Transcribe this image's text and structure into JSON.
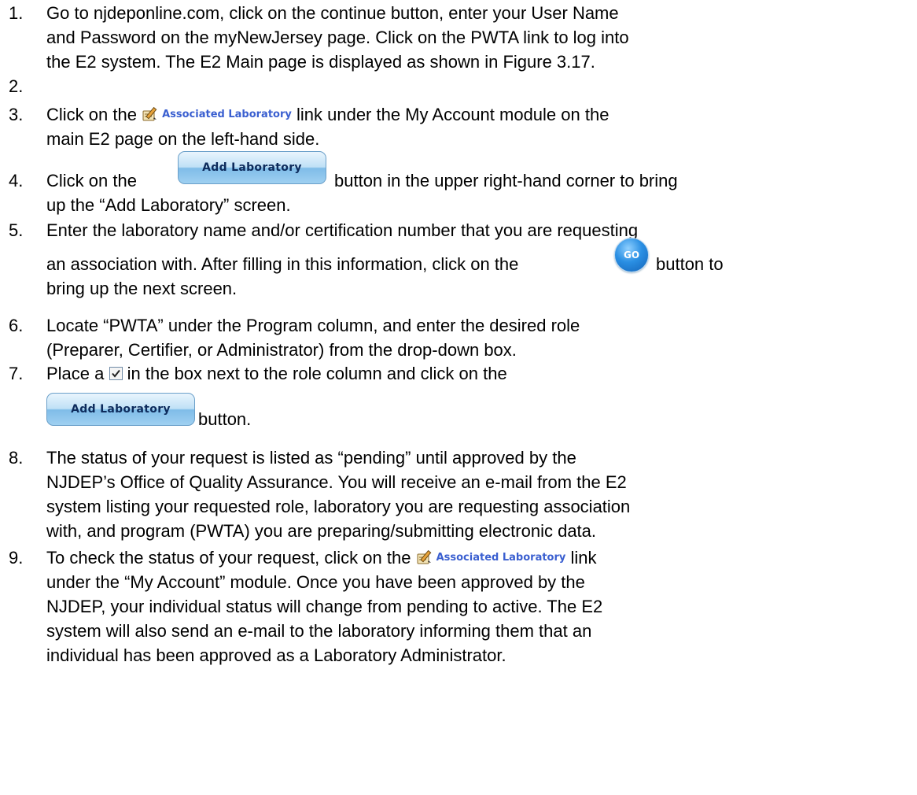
{
  "steps": [
    {
      "num": "1.",
      "lines": [
        "Go to njdeponline.com, click on the continue button, enter your User Name",
        "and Password on the myNewJersey page.  Click on the PWTA link to log into",
        "the E2 system.  The E2 Main page is displayed as shown in Figure 3.17."
      ]
    },
    {
      "num": "2."
    },
    {
      "num": "3.",
      "before": "Click on the",
      "after": "link under the My Account module on the",
      "line2": "main E2 page on the left-hand side."
    },
    {
      "num": "4.",
      "before": "Click on the",
      "after": "button in the upper right-hand corner to bring",
      "line2": "up the “Add Laboratory” screen."
    },
    {
      "num": "5.",
      "line1": "Enter the laboratory name and/or certification number that you are requesting",
      "before": "an association with.  After filling in this information, click on the",
      "after": "button to",
      "line3": "bring up the next screen."
    },
    {
      "num": "6.",
      "lines": [
        "Locate “PWTA” under the Program column, and enter the desired role",
        "(Preparer, Certifier, or Administrator) from the drop-down box."
      ]
    },
    {
      "num": "7.",
      "before": "Place a",
      "after": "in the box next to the role column and click on the",
      "line2_after": "button."
    },
    {
      "num": "8.",
      "lines": [
        "The status of your request is listed as “pending” until approved by the",
        "NJDEP’s Office of Quality Assurance.  You will receive an e-mail from the E2",
        "system listing your requested role, laboratory you are requesting association",
        "with, and program (PWTA) you are preparing/submitting electronic data."
      ]
    },
    {
      "num": "9.",
      "before": "To check the status of your request, click on the",
      "after": "link",
      "lines": [
        "under the “My Account” module.  Once you have been approved by the",
        "NJDEP, your individual status will change from pending to active.  The E2",
        "system will also send an e-mail to the laboratory informing them that an",
        "individual has been approved as a Laboratory Administrator."
      ]
    }
  ],
  "graphics": {
    "associated_laboratory_link": "Associated Laboratory",
    "associated_laboratory_icon": "pencil-notepad-icon",
    "add_laboratory_button": "Add Laboratory",
    "go_button": "GO",
    "checkbox_icon": "checked-checkbox-icon"
  },
  "colors": {
    "link_text": "#3a5fd0",
    "button_text": "#0d2b5c",
    "go_button": "#1e7fd6"
  }
}
